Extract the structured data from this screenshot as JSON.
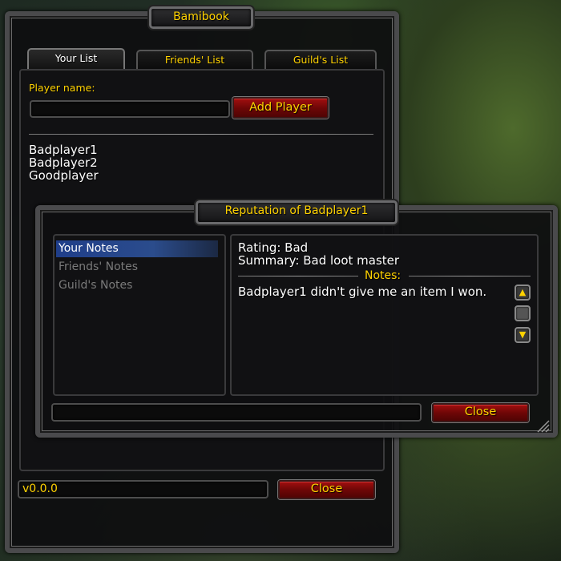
{
  "bamibook": {
    "title": "Bamibook",
    "tabs": [
      {
        "label": "Your List",
        "active": true
      },
      {
        "label": "Friends' List",
        "active": false
      },
      {
        "label": "Guild's List",
        "active": false
      }
    ],
    "player_name_label": "Player name:",
    "player_name_value": "",
    "add_player_label": "Add Player",
    "players": [
      "Badplayer1",
      "Badplayer2",
      "Goodplayer"
    ],
    "version": "v0.0.0",
    "close_label": "Close"
  },
  "reputation": {
    "title": "Reputation of Badplayer1",
    "note_sources": [
      {
        "label": "Your Notes",
        "selected": true
      },
      {
        "label": "Friends' Notes",
        "selected": false
      },
      {
        "label": "Guild's Notes",
        "selected": false
      }
    ],
    "rating": "Rating: Bad",
    "summary": "Summary: Bad loot master",
    "notes_label": "Notes:",
    "note_text": "Badplayer1 didn't give me an item I won.",
    "bottom_input_value": "",
    "close_label": "Close"
  },
  "colors": {
    "gold_text": "#ffd200",
    "button_red": "#8b0a0a",
    "selection_blue": "#2b4c8c"
  },
  "icons": {
    "scroll_up": "scroll-up-icon",
    "scroll_down": "scroll-down-icon",
    "resize_grip": "resize-grip-icon"
  }
}
